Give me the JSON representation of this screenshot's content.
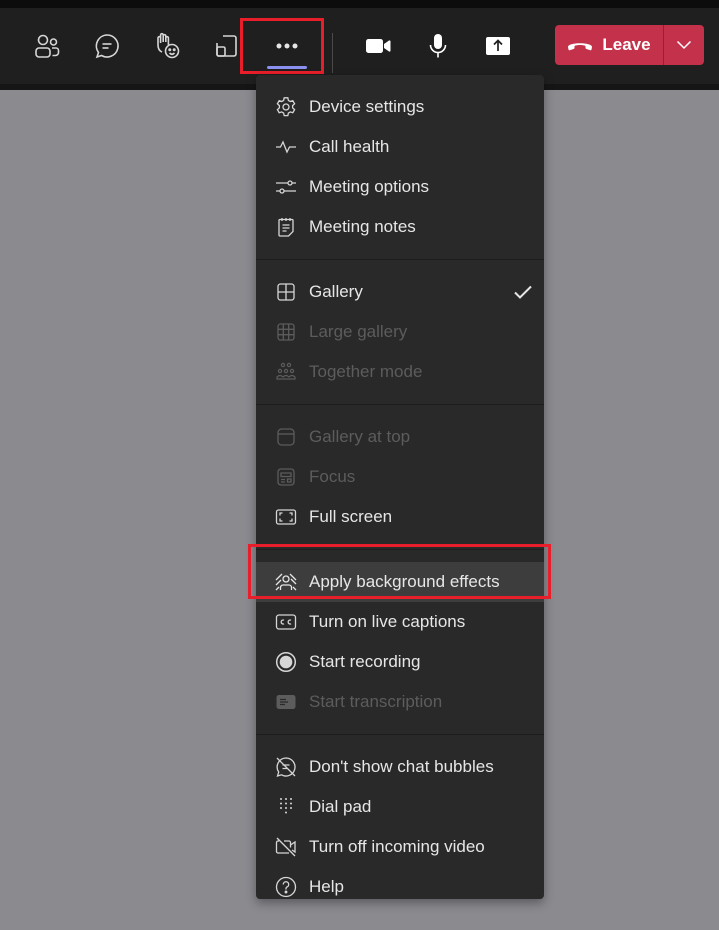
{
  "toolbar": {
    "buttons": [
      {
        "name": "people",
        "icon": "people-icon"
      },
      {
        "name": "chat",
        "icon": "chat-icon"
      },
      {
        "name": "reactions",
        "icon": "raise-hand-icon"
      },
      {
        "name": "rooms",
        "icon": "share-tray-icon"
      },
      {
        "name": "more-actions",
        "icon": "more-icon",
        "active": true
      },
      {
        "name": "camera",
        "icon": "camera-icon"
      },
      {
        "name": "mic",
        "icon": "microphone-icon"
      },
      {
        "name": "share",
        "icon": "share-screen-icon"
      }
    ],
    "leave_label": "Leave",
    "leave_color": "#c4314b",
    "active_indicator_color": "#8b8ff0",
    "annotation_color": "#e81f2a"
  },
  "menu": {
    "sections": [
      {
        "items": [
          {
            "label": "Device settings",
            "icon": "gear-icon",
            "enabled": true
          },
          {
            "label": "Call health",
            "icon": "pulse-icon",
            "enabled": true
          },
          {
            "label": "Meeting options",
            "icon": "sliders-icon",
            "enabled": true
          },
          {
            "label": "Meeting notes",
            "icon": "notes-icon",
            "enabled": true
          }
        ]
      },
      {
        "items": [
          {
            "label": "Gallery",
            "icon": "gallery-icon",
            "enabled": true,
            "checked": true
          },
          {
            "label": "Large gallery",
            "icon": "large-gallery-icon",
            "enabled": false
          },
          {
            "label": "Together mode",
            "icon": "together-mode-icon",
            "enabled": false
          }
        ]
      },
      {
        "items": [
          {
            "label": "Gallery at top",
            "icon": "gallery-top-icon",
            "enabled": false
          },
          {
            "label": "Focus",
            "icon": "focus-icon",
            "enabled": false
          },
          {
            "label": "Full screen",
            "icon": "fullscreen-icon",
            "enabled": true
          }
        ]
      },
      {
        "items": [
          {
            "label": "Apply background effects",
            "icon": "background-effects-icon",
            "enabled": true,
            "hovered": true
          },
          {
            "label": "Turn on live captions",
            "icon": "captions-icon",
            "enabled": true
          },
          {
            "label": "Start recording",
            "icon": "record-icon",
            "enabled": true
          },
          {
            "label": "Start transcription",
            "icon": "transcription-icon",
            "enabled": false
          }
        ]
      },
      {
        "items": [
          {
            "label": "Don't show chat bubbles",
            "icon": "chat-bubbles-off-icon",
            "enabled": true
          },
          {
            "label": "Dial pad",
            "icon": "dialpad-icon",
            "enabled": true
          },
          {
            "label": "Turn off incoming video",
            "icon": "video-off-icon",
            "enabled": true
          },
          {
            "label": "Help",
            "icon": "help-icon",
            "enabled": true
          }
        ]
      }
    ]
  }
}
